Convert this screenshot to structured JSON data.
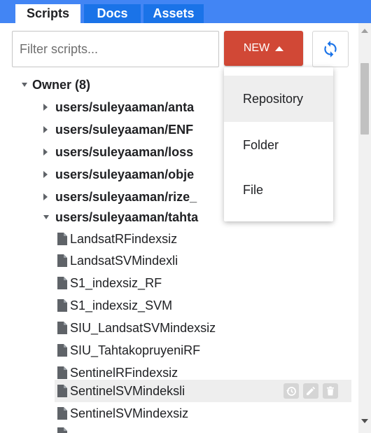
{
  "tabs": [
    {
      "label": "Scripts",
      "active": true
    },
    {
      "label": "Docs",
      "active": false
    },
    {
      "label": "Assets",
      "active": false
    }
  ],
  "toolbar": {
    "filter_placeholder": "Filter scripts...",
    "filter_value": "",
    "new_label": "NEW",
    "refresh_icon": "refresh-icon"
  },
  "tree": {
    "owner_label": "Owner (8)",
    "folders": [
      {
        "label": "users/suleyaaman/anta",
        "expanded": false
      },
      {
        "label": "users/suleyaaman/ENF",
        "expanded": false
      },
      {
        "label": "users/suleyaaman/loss",
        "expanded": false
      },
      {
        "label": "users/suleyaaman/obje",
        "expanded": false
      },
      {
        "label": "users/suleyaaman/rize_",
        "expanded": false
      },
      {
        "label": "users/suleyaaman/tahta",
        "expanded": true
      }
    ],
    "files": [
      {
        "label": "LandsatRFindexsiz"
      },
      {
        "label": "LandsatSVMindexli"
      },
      {
        "label": "S1_indexsiz_RF"
      },
      {
        "label": "S1_indexsiz_SVM"
      },
      {
        "label": "SIU_LandsatSVMindexsiz"
      },
      {
        "label": "SIU_TahtakopruyeniRF"
      },
      {
        "label": "SentinelRFindexsiz"
      },
      {
        "label": "SentinelSVMindeksli",
        "selected": true
      },
      {
        "label": "SentinelSVMindexsiz"
      }
    ]
  },
  "menu": {
    "items": [
      {
        "label": "Repository",
        "hover": true
      },
      {
        "label": "Folder"
      },
      {
        "label": "File"
      }
    ]
  },
  "colors": {
    "tab_bar": "#4285f4",
    "tab_inactive": "#1a73e8",
    "new_button": "#d14836",
    "refresh_icon": "#1a73e8"
  }
}
